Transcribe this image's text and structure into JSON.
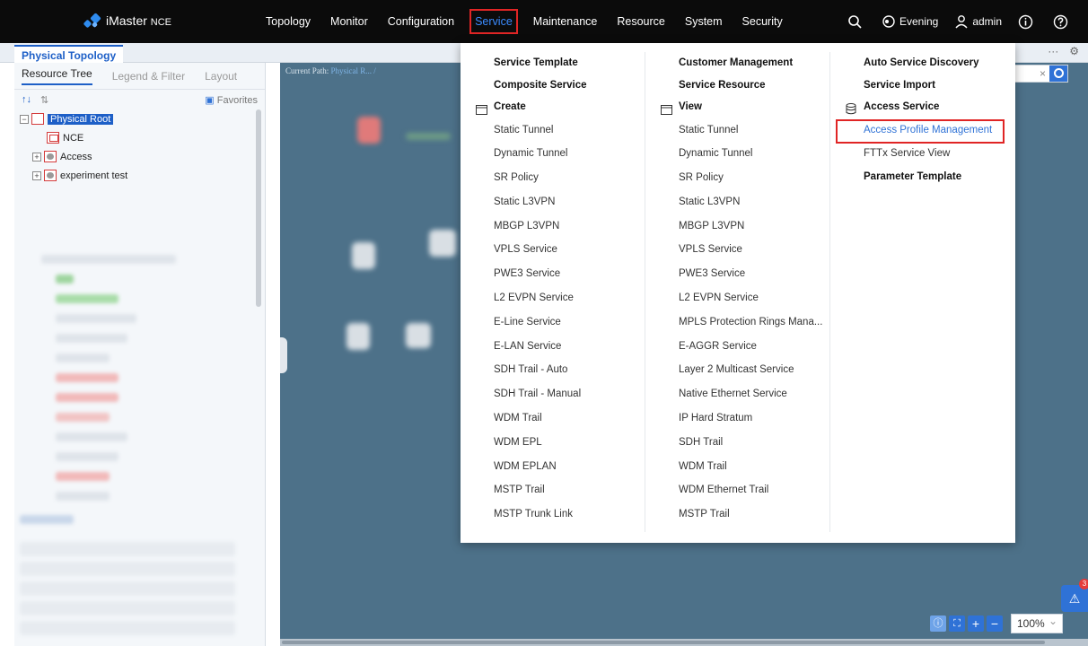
{
  "app": {
    "logo_text": "iMaster",
    "logo_sub": "NCE"
  },
  "topnav": {
    "items": [
      "Topology",
      "Monitor",
      "Configuration",
      "Service",
      "Maintenance",
      "Resource",
      "System",
      "Security"
    ],
    "active": "Service",
    "theme_label": "Evening",
    "user_label": "admin"
  },
  "tabstrip": {
    "tab_label": "Physical Topology",
    "more_label": "···"
  },
  "left_panel": {
    "tabs": [
      "Resource Tree",
      "Legend & Filter",
      "Layout"
    ],
    "favorites_label": "Favorites",
    "sort_asc_label": "↑↓",
    "sort_desc_label": "⇅",
    "tree": {
      "root": "Physical Root",
      "children": [
        "NCE",
        "Access",
        "experiment test"
      ]
    }
  },
  "canvas": {
    "current_path_label": "Current Path:",
    "current_path_value": "Physical R... /",
    "search_clear": "×"
  },
  "zoom": {
    "level": "100%",
    "plus": "+",
    "minus": "−"
  },
  "alarm": {
    "badge_count": "3"
  },
  "dropdown": {
    "col1": {
      "heads": [
        "Service Template",
        "Composite Service"
      ],
      "group": "Create",
      "items": [
        "Static Tunnel",
        "Dynamic Tunnel",
        "SR Policy",
        "Static L3VPN",
        "MBGP L3VPN",
        "VPLS Service",
        "PWE3 Service",
        "L2 EVPN Service",
        "E-Line Service",
        "E-LAN Service",
        "SDH Trail - Auto",
        "SDH Trail - Manual",
        "WDM Trail",
        "WDM EPL",
        "WDM EPLAN",
        "MSTP Trail",
        "MSTP Trunk Link"
      ]
    },
    "col2": {
      "heads": [
        "Customer Management",
        "Service Resource"
      ],
      "group": "View",
      "items": [
        "Static Tunnel",
        "Dynamic Tunnel",
        "SR Policy",
        "Static L3VPN",
        "MBGP L3VPN",
        "VPLS Service",
        "PWE3 Service",
        "L2 EVPN Service",
        "MPLS Protection Rings Mana...",
        "E-AGGR Service",
        "Layer 2 Multicast Service",
        "Native Ethernet Service",
        "IP Hard Stratum",
        "SDH Trail",
        "WDM Trail",
        "WDM Ethernet Trail",
        "MSTP Trail"
      ]
    },
    "col3": {
      "heads": [
        "Auto Service Discovery",
        "Service Import"
      ],
      "group": "Access Service",
      "items": [
        "Access Profile Management",
        "FTTx Service View"
      ],
      "tail": "Parameter Template"
    }
  },
  "colors": {
    "topbar": "#0b0b0b",
    "accent": "#2f72d6",
    "highlight_box": "#e02525",
    "canvas": "#4d7189"
  }
}
